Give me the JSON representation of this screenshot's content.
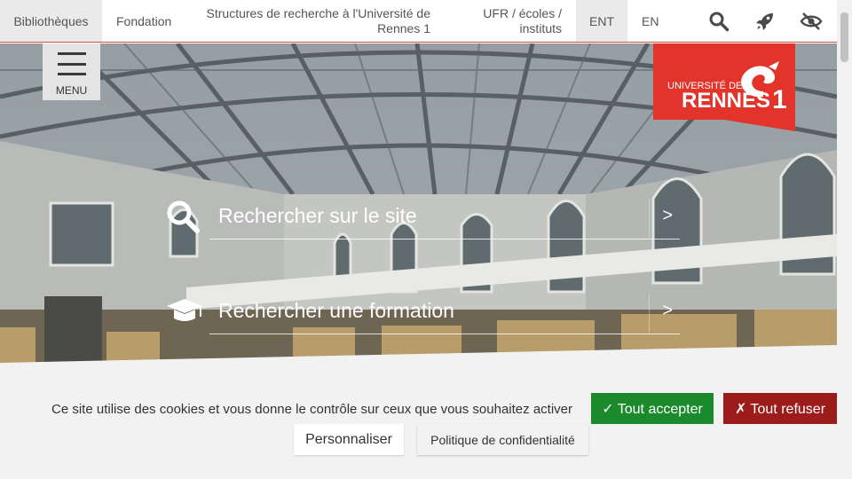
{
  "topbar": {
    "bibliotheques": "Bibliothèques",
    "fondation": "Fondation",
    "structures": "Structures de recherche à l'Université de Rennes 1",
    "ufr": "UFR / écoles / instituts",
    "ent": "ENT",
    "en": "EN",
    "icons": [
      "search-icon",
      "rocket-icon",
      "eye-slash-icon"
    ]
  },
  "menu": {
    "label": "MENU"
  },
  "logo": {
    "line1": "UNIVERSITÉ DE",
    "line2": "RENNES",
    "digit": "1",
    "color": "#e2342b"
  },
  "search": {
    "site": "Rechercher sur le site",
    "formation": "Rechercher une formation",
    "arrow": ">"
  },
  "cookie": {
    "message": "Ce site utilise des cookies et vous donne le contrôle sur ceux que vous souhaitez activer",
    "accept": "✓ Tout accepter",
    "refuse": "✗ Tout refuser",
    "customize": "Personnaliser",
    "policy": "Politique de confidentialité",
    "accept_color": "#1b8a2c",
    "refuse_color": "#9c1c1c"
  }
}
